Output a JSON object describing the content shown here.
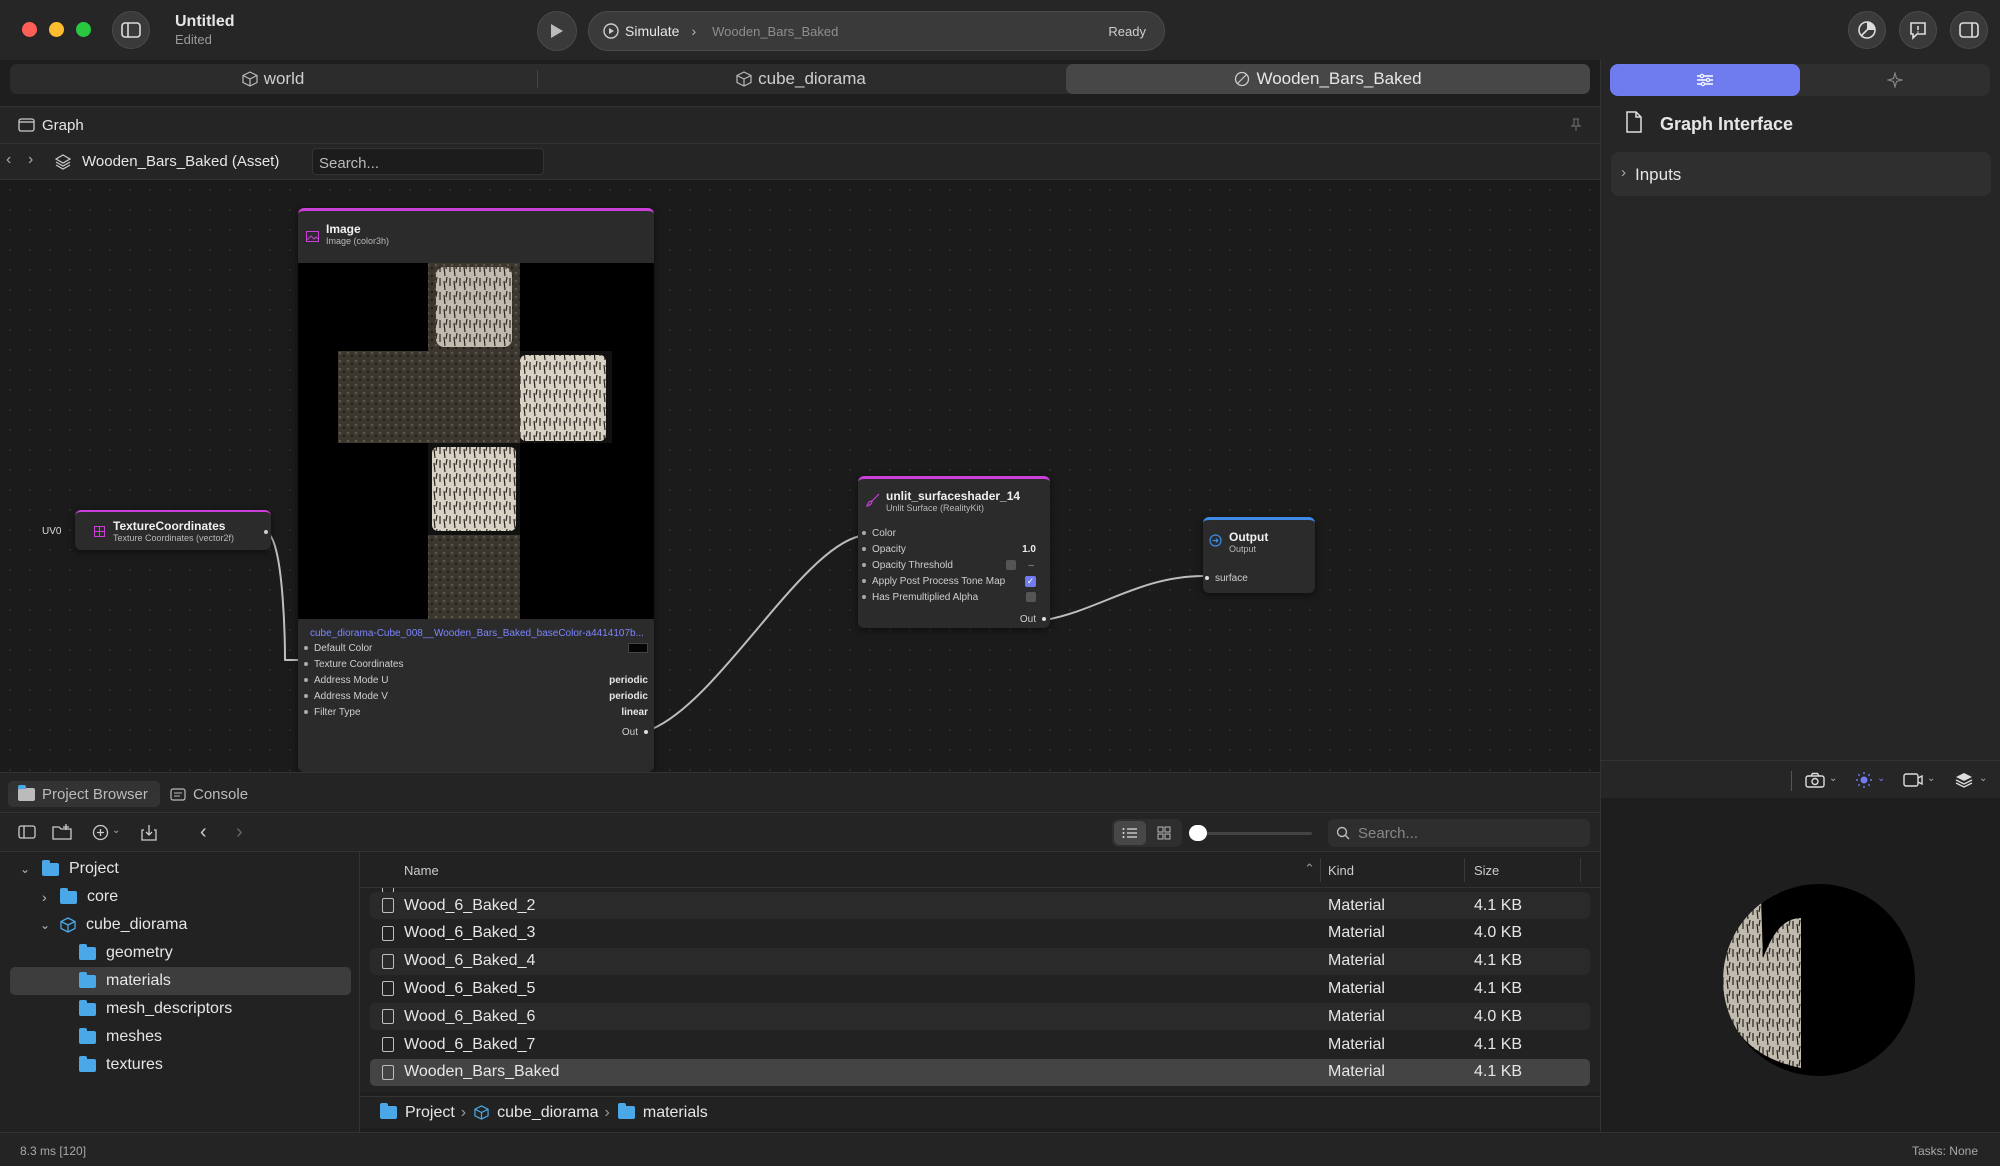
{
  "window": {
    "title": "Untitled",
    "subtitle": "Edited"
  },
  "simulate": {
    "label": "Simulate",
    "target": "Wooden_Bars_Baked",
    "status": "Ready"
  },
  "doc_tabs": [
    {
      "label": "world",
      "icon": "cube-icon"
    },
    {
      "label": "cube_diorama",
      "icon": "cube-icon"
    },
    {
      "label": "Wooden_Bars_Baked",
      "icon": "material-sphere-icon"
    }
  ],
  "graph": {
    "header_label": "Graph",
    "breadcrumb": "Wooden_Bars_Baked (Asset)",
    "search_placeholder": "Search..."
  },
  "nodes": {
    "texcoord": {
      "title": "TextureCoordinates",
      "subtitle": "Texture Coordinates (vector2f)",
      "input_label": "UV0"
    },
    "image": {
      "title": "Image",
      "subtitle": "Image (color3h)",
      "file": "cube_diorama-Cube_008__Wooden_Bars_Baked_baseColor-a4414107b...",
      "rows": [
        {
          "label": "Default Color",
          "value": ""
        },
        {
          "label": "Texture Coordinates",
          "value": ""
        },
        {
          "label": "Address Mode U",
          "value": "periodic"
        },
        {
          "label": "Address Mode V",
          "value": "periodic"
        },
        {
          "label": "Filter Type",
          "value": "linear"
        }
      ],
      "out": "Out"
    },
    "shader": {
      "title": "unlit_surfaceshader_14",
      "subtitle": "Unlit Surface (RealityKit)",
      "rows": [
        {
          "label": "Color",
          "value": ""
        },
        {
          "label": "Opacity",
          "value": "1.0"
        },
        {
          "label": "Opacity Threshold",
          "value": "–"
        },
        {
          "label": "Apply Post Process Tone Map",
          "value": ""
        },
        {
          "label": "Has Premultiplied Alpha",
          "value": ""
        }
      ],
      "out": "Out"
    },
    "output": {
      "title": "Output",
      "subtitle": "Output",
      "input": "surface"
    }
  },
  "inspector": {
    "title": "Graph Interface",
    "section": "Inputs"
  },
  "browser": {
    "tabs": [
      "Project Browser",
      "Console"
    ],
    "search_placeholder": "Search...",
    "tree": [
      {
        "label": "Project",
        "level": 0,
        "chevron": "down",
        "icon": "folder-icon"
      },
      {
        "label": "core",
        "level": 1,
        "chevron": "right",
        "icon": "folder-icon"
      },
      {
        "label": "cube_diorama",
        "level": 1,
        "chevron": "down",
        "icon": "package-icon"
      },
      {
        "label": "geometry",
        "level": 2,
        "chevron": "",
        "icon": "folder-icon"
      },
      {
        "label": "materials",
        "level": 2,
        "chevron": "",
        "icon": "folder-icon"
      },
      {
        "label": "mesh_descriptors",
        "level": 2,
        "chevron": "",
        "icon": "folder-icon"
      },
      {
        "label": "meshes",
        "level": 2,
        "chevron": "",
        "icon": "folder-icon"
      },
      {
        "label": "textures",
        "level": 2,
        "chevron": "",
        "icon": "folder-icon"
      }
    ],
    "columns": {
      "name": "Name",
      "kind": "Kind",
      "size": "Size"
    },
    "files": [
      {
        "name": "Wood_6_Baked_2",
        "kind": "Material",
        "size": "4.1 KB"
      },
      {
        "name": "Wood_6_Baked_3",
        "kind": "Material",
        "size": "4.0 KB"
      },
      {
        "name": "Wood_6_Baked_4",
        "kind": "Material",
        "size": "4.1 KB"
      },
      {
        "name": "Wood_6_Baked_5",
        "kind": "Material",
        "size": "4.1 KB"
      },
      {
        "name": "Wood_6_Baked_6",
        "kind": "Material",
        "size": "4.0 KB"
      },
      {
        "name": "Wood_6_Baked_7",
        "kind": "Material",
        "size": "4.1 KB"
      },
      {
        "name": "Wooden_Bars_Baked",
        "kind": "Material",
        "size": "4.1 KB"
      }
    ],
    "path": [
      "Project",
      "cube_diorama",
      "materials"
    ]
  },
  "status": {
    "left": "8.3 ms [120]",
    "right": "Tasks: None"
  },
  "colors": {
    "accent": "#6f7cf0",
    "node_header_magenta": "#c93fd8",
    "output_header_blue": "#3d8ae8",
    "folder": "#4aa8e8"
  }
}
